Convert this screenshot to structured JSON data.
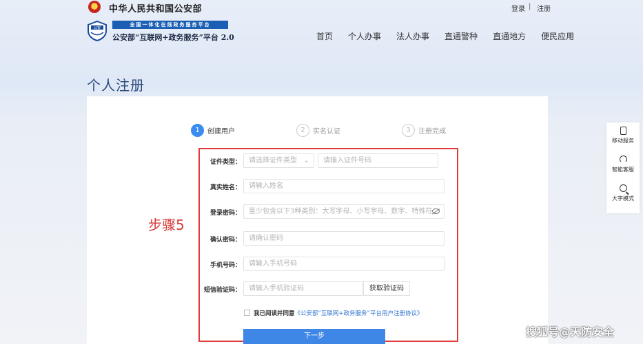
{
  "top_bar": {
    "site_name": "中华人民共和国公安部",
    "login_label": "登录",
    "separator": "|",
    "register_label": "注册"
  },
  "header": {
    "banner_strip": "全国一体化在线政务服务平台",
    "platform_name": "公安部“互联网+政务服务”平台 2.0",
    "shield_text": "公安",
    "nav": [
      "首页",
      "个人办事",
      "法人办事",
      "直通警种",
      "直通地方",
      "便民应用"
    ]
  },
  "page_title": "个人注册",
  "steps": [
    {
      "number": "1",
      "label": "创建用户",
      "active": true
    },
    {
      "number": "2",
      "label": "实名认证",
      "active": false
    },
    {
      "number": "3",
      "label": "注册完成",
      "active": false
    }
  ],
  "form": {
    "id_type_label": "证件类型：",
    "id_type_placeholder": "请选择证件类型",
    "id_number_placeholder": "请输入证件号码",
    "real_name_label": "真实姓名：",
    "real_name_placeholder": "请输入姓名",
    "password_label": "登录密码：",
    "password_placeholder": "至少包含以下3种类别：大写字母、小写字母、数字、特殊符…",
    "confirm_label": "确认密码：",
    "confirm_placeholder": "请确认密码",
    "phone_label": "手机号码：",
    "phone_placeholder": "请输入手机号码",
    "sms_label": "短信验证码：",
    "sms_placeholder": "请输入手机验证码",
    "sms_button": "获取验证码",
    "agree_prefix": "我已阅读并同意",
    "agree_link": "《公安部“互联网+政务服务”平台用户注册协议》",
    "next_button": "下一步"
  },
  "annotation": "步骤5",
  "float_panel": [
    {
      "icon": "mobile-icon",
      "label": "移动服务"
    },
    {
      "icon": "headset-icon",
      "label": "智能客服"
    },
    {
      "icon": "magnifier-icon",
      "label": "大字模式"
    }
  ],
  "watermark": "搜狐号@天防安全",
  "colors": {
    "accent": "#3f87e6",
    "highlight_border": "#e23b3b",
    "annotation": "#d63b3b",
    "title": "#2c4a7b"
  }
}
